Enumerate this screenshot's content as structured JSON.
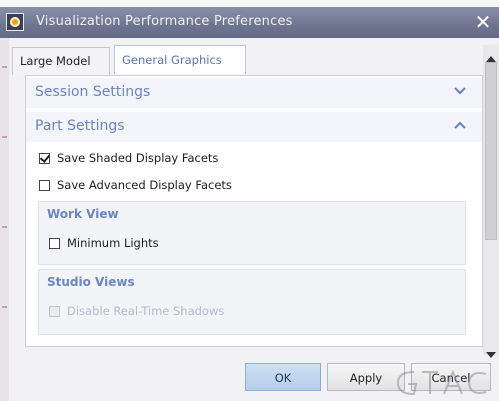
{
  "window": {
    "title": "Visualization Performance Preferences",
    "close_glyph": "✕"
  },
  "tabs": [
    {
      "label": "Large Model",
      "active": false
    },
    {
      "label": "General Graphics",
      "active": true
    }
  ],
  "sections": {
    "session": {
      "label": "Session Settings",
      "state": "collapsed",
      "icon": "chevron-down-icon"
    },
    "part": {
      "label": "Part Settings",
      "state": "expanded",
      "icon": "chevron-up-icon"
    }
  },
  "checkboxes": {
    "save_shaded": {
      "label": "Save Shaded Display Facets",
      "checked": true
    },
    "save_advanced": {
      "label": "Save Advanced Display Facets",
      "checked": false
    },
    "minimum_lights": {
      "label": "Minimum Lights",
      "checked": false
    },
    "disable_shadows": {
      "label": "Disable Real-Time Shadows",
      "checked": false,
      "disabled": true
    }
  },
  "groups": {
    "work_view": {
      "title": "Work View"
    },
    "studio_views": {
      "title": "Studio Views"
    }
  },
  "buttons": {
    "ok": "OK",
    "apply": "Apply",
    "cancel": "Cancel"
  },
  "colors": {
    "accent": "#6b86c2",
    "titlebar": "#6e7590",
    "ok_button": "#b7cfea"
  }
}
